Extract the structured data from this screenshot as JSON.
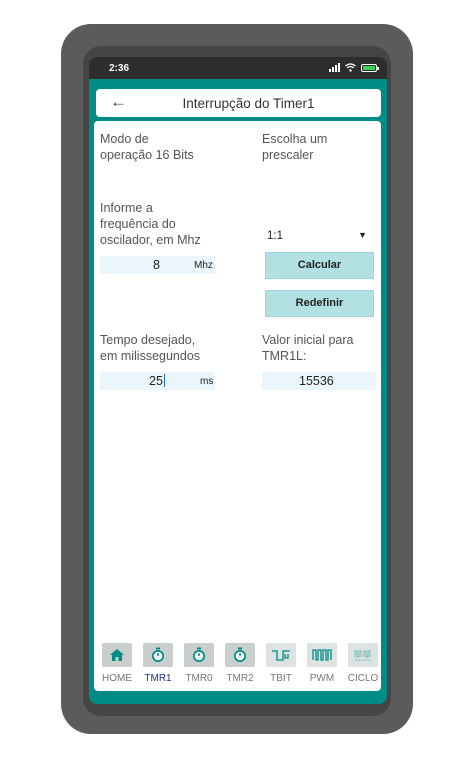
{
  "status": {
    "time": "2:36"
  },
  "app_bar": {
    "title": "Interrupção do Timer1"
  },
  "mode": {
    "label": "Modo de\noperação 16 Bits"
  },
  "prescaler": {
    "label": "Escolha um\nprescaler",
    "selected": "1:1"
  },
  "frequency": {
    "label": "Informe a\nfrequência do\noscilador, em Mhz",
    "value": "8",
    "unit": "Mhz"
  },
  "buttons": {
    "calculate": "Calcular",
    "reset": "Redefinir"
  },
  "time": {
    "label": "Tempo desejado,\nem milissegundos",
    "value": "25",
    "unit": "ms"
  },
  "initial": {
    "label": "Valor inicial para\nTMR1L:",
    "value": "15536"
  },
  "nav": {
    "items": [
      {
        "label": "HOME",
        "icon": "home-icon"
      },
      {
        "label": "TMR1",
        "icon": "stopwatch-icon",
        "active": true
      },
      {
        "label": "TMR0",
        "icon": "stopwatch-icon"
      },
      {
        "label": "TMR2",
        "icon": "stopwatch-icon"
      },
      {
        "label": "TBIT",
        "icon": "pulse-icon"
      },
      {
        "label": "PWM",
        "icon": "pwm-wave-icon"
      },
      {
        "label": "CICLO",
        "icon": "cycle-wave-icon"
      }
    ]
  },
  "colors": {
    "accent": "#008c86",
    "field": "#ebf5fc",
    "button": "#b2e0e3",
    "active_nav": "#1f2e8c"
  }
}
